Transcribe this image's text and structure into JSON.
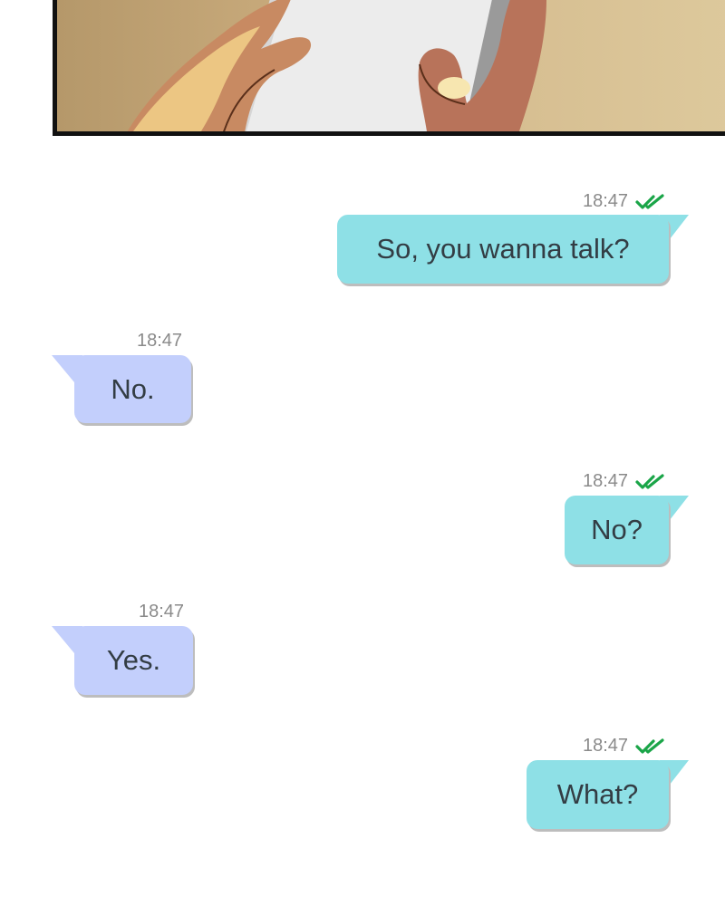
{
  "panel": {
    "image": "hands-holding-phone-illustration"
  },
  "colors": {
    "sent_bubble": "#8ee0e6",
    "received_bubble": "#c3cffc",
    "read_checks": "#1aa548",
    "timestamp": "#8a8a8a",
    "message_text": "#333d44"
  },
  "messages": [
    {
      "direction": "sent",
      "time": "18:47",
      "text": "So, you wanna talk?",
      "status_icon": "double-check-icon"
    },
    {
      "direction": "received",
      "time": "18:47",
      "text": "No."
    },
    {
      "direction": "sent",
      "time": "18:47",
      "text": "No?",
      "status_icon": "double-check-icon"
    },
    {
      "direction": "received",
      "time": "18:47",
      "text": "Yes."
    },
    {
      "direction": "sent",
      "time": "18:47",
      "text": "What?",
      "status_icon": "double-check-icon"
    }
  ]
}
